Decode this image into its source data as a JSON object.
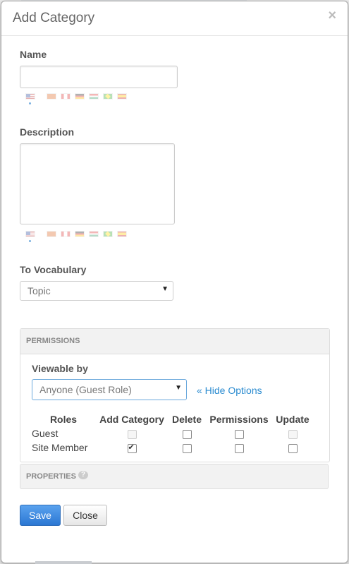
{
  "modal": {
    "title": "Add Category",
    "close_glyph": "×"
  },
  "name": {
    "label": "Name",
    "value": "",
    "flags": [
      "us-flag-icon",
      "cn-flag-icon",
      "ca-flag-icon",
      "de-flag-icon",
      "hu-flag-icon",
      "br-flag-icon",
      "es-flag-icon"
    ]
  },
  "description": {
    "label": "Description",
    "value": ""
  },
  "vocabulary": {
    "label": "To Vocabulary",
    "selected": "Topic"
  },
  "permissions": {
    "heading": "Permissions",
    "viewable_label": "Viewable by",
    "viewable_selected": "Anyone (Guest Role)",
    "hide_options": "« Hide Options",
    "columns": [
      "Roles",
      "Add Category",
      "Delete",
      "Permissions",
      "Update"
    ],
    "rows": [
      {
        "role": "Guest",
        "add_category": {
          "checked": false,
          "disabled": true
        },
        "delete": {
          "checked": false,
          "disabled": false
        },
        "permissions": {
          "checked": false,
          "disabled": false
        },
        "update": {
          "checked": false,
          "disabled": true
        }
      },
      {
        "role": "Site Member",
        "add_category": {
          "checked": true,
          "disabled": false
        },
        "delete": {
          "checked": false,
          "disabled": false
        },
        "permissions": {
          "checked": false,
          "disabled": false
        },
        "update": {
          "checked": false,
          "disabled": false
        }
      }
    ]
  },
  "properties": {
    "heading": "Properties",
    "icon": "help-icon"
  },
  "buttons": {
    "save": "Save",
    "close": "Close"
  },
  "colors": {
    "primary": "#2b77d3",
    "link": "#2a8bd0"
  }
}
